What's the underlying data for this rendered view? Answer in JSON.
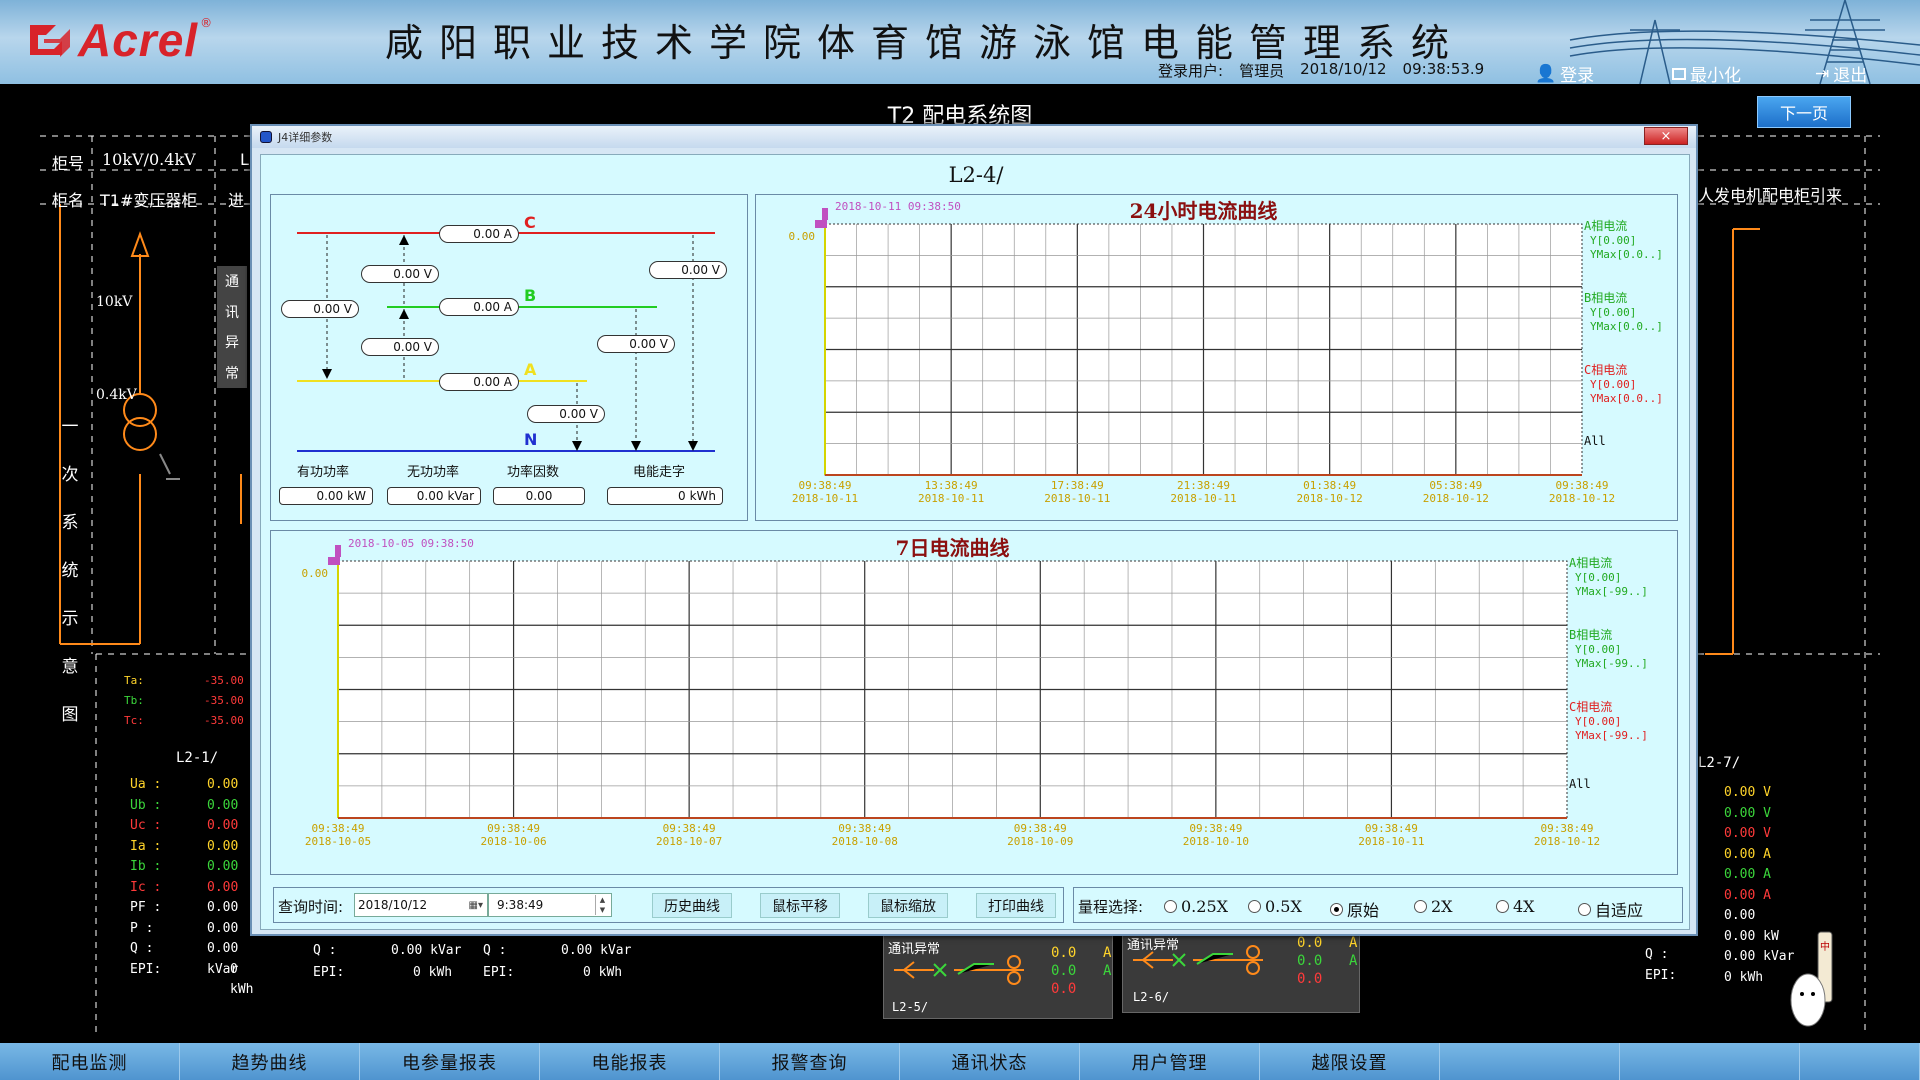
{
  "header": {
    "logo_text": "Acrel",
    "logo_reg": "®",
    "system_title": "咸阳职业技术学院体育馆游泳馆电能管理系统",
    "login_user_label": "登录用户:",
    "login_user": "管理员",
    "date": "2018/10/12",
    "time": "09:38:53.9",
    "login_btn": "登录",
    "minimize_btn": "最小化",
    "exit_btn": "退出"
  },
  "page": {
    "title": "T2 配电系统图",
    "next_page": "下一页"
  },
  "background": {
    "cabinet_no_label": "柜号",
    "cabinet_no_value": "10kV/0.4kV",
    "cabinet_no_next": "L",
    "cabinet_name_label": "柜名",
    "cabinet_name_value": "T1#变压器柜",
    "cabinet_name_next": "进",
    "right_header": "人发电机配电柜引来",
    "hv_label": "10kV",
    "lv_label": "0.4kV",
    "comm_error_vertical": [
      "通",
      "讯",
      "异",
      "常"
    ],
    "side_vertical": [
      "一",
      "次",
      "系",
      "统",
      "示",
      "意",
      "图"
    ],
    "temps": [
      {
        "label": "Ta:",
        "value": "-35.00"
      },
      {
        "label": "Tb:",
        "value": "-35.00"
      },
      {
        "label": "Tc:",
        "value": "-35.00"
      }
    ],
    "left_feeder": "L2-1/",
    "right_feeder": "L2-7/",
    "left_params": [
      {
        "label": "Ua :",
        "value": "0.00"
      },
      {
        "label": "Ub :",
        "value": "0.00"
      },
      {
        "label": "Uc :",
        "value": "0.00"
      },
      {
        "label": "Ia :",
        "value": "0.00"
      },
      {
        "label": "Ib :",
        "value": "0.00"
      },
      {
        "label": "Ic :",
        "value": "0.00"
      },
      {
        "label": "PF :",
        "value": "0.00"
      },
      {
        "label": "P :",
        "value": "0.00"
      },
      {
        "label": "Q :",
        "value": "0.00 kVar"
      },
      {
        "label": "EPI:",
        "value": "0 kWh"
      }
    ],
    "mid_q": [
      {
        "label": "Q :",
        "value": "0.00 kVar"
      },
      {
        "label": "Q :",
        "value": "0.00 kVar"
      }
    ],
    "mid_epi": [
      {
        "label": "EPI:",
        "value": "0 kWh"
      },
      {
        "label": "EPI:",
        "value": "0 kWh"
      }
    ],
    "right_params": [
      "0.00 V",
      "0.00 V",
      "0.00 V",
      "0.00 A",
      "0.00 A",
      "0.00 A",
      "0.00",
      "0.00 kW",
      "0.00 kVar",
      "0 kWh"
    ],
    "right_q_label": "Q :",
    "right_epi_label": "EPI:",
    "l25_comm": "通讯异常",
    "l25_name": "L2-5/",
    "l26_comm": "通讯异常",
    "l26_name": "L2-6/",
    "l25_vals": [
      "0.0",
      "0.0",
      "0.0"
    ],
    "l26_vals": [
      "0.0",
      "0.0",
      "0.0"
    ],
    "unit_a": "A"
  },
  "dialog": {
    "window_title": "J4详细参数",
    "close": "×",
    "heading": "L2-4/",
    "phases": {
      "c": "C",
      "b": "B",
      "a": "A",
      "n": "N"
    },
    "values": {
      "ic": "0.00 A",
      "ib": "0.00 A",
      "ia": "0.00 A",
      "ubc": "0.00 V",
      "uab": "0.00 V",
      "uca": "0.00 V",
      "uc": "0.00 V",
      "ub": "0.00 V",
      "ua": "0.00 V"
    },
    "power_labels": [
      "有功功率",
      "无功功率",
      "功率因数",
      "电能走字"
    ],
    "power_values": [
      {
        "num": "0.00",
        "unit": "kW"
      },
      {
        "num": "0.00",
        "unit": "kVar"
      },
      {
        "num": "0.00",
        "unit": ""
      },
      {
        "num": "0",
        "unit": "kWh"
      }
    ],
    "query_label": "查询时间:",
    "query_date": "2018/10/12",
    "query_time": "9:38:49",
    "buttons": [
      "历史曲线",
      "鼠标平移",
      "鼠标缩放",
      "打印曲线"
    ],
    "range_label": "量程选择:",
    "range_options": [
      "0.25X",
      "0.5X",
      "原始",
      "2X",
      "4X",
      "自适应"
    ],
    "range_selected": 2
  },
  "chart_data": [
    {
      "type": "line",
      "title": "24小时电流曲线",
      "cursor_label": "2018-10-11 09:38:50",
      "y_value_label": "0.00",
      "x": [
        [
          "09:38:49",
          "2018-10-11"
        ],
        [
          "13:38:49",
          "2018-10-11"
        ],
        [
          "17:38:49",
          "2018-10-11"
        ],
        [
          "21:38:49",
          "2018-10-11"
        ],
        [
          "01:38:49",
          "2018-10-12"
        ],
        [
          "05:38:49",
          "2018-10-12"
        ],
        [
          "09:38:49",
          "2018-10-12"
        ]
      ],
      "series": [
        {
          "name": "A相电流",
          "y": "Y[0.00]",
          "ymax": "YMax[0.0..]",
          "values": [
            0,
            0,
            0,
            0,
            0,
            0,
            0
          ],
          "color": "#22aa22"
        },
        {
          "name": "B相电流",
          "y": "Y[0.00]",
          "ymax": "YMax[0.0..]",
          "values": [
            0,
            0,
            0,
            0,
            0,
            0,
            0
          ],
          "color": "#22aa22"
        },
        {
          "name": "C相电流",
          "y": "Y[0.00]",
          "ymax": "YMax[0.0..]",
          "values": [
            0,
            0,
            0,
            0,
            0,
            0,
            0
          ],
          "color": "#e02020"
        }
      ],
      "legend_all": "All",
      "grid": true
    },
    {
      "type": "line",
      "title": "7日电流曲线",
      "cursor_label": "2018-10-05 09:38:50",
      "y_value_label": "0.00",
      "x": [
        [
          "09:38:49",
          "2018-10-05"
        ],
        [
          "09:38:49",
          "2018-10-06"
        ],
        [
          "09:38:49",
          "2018-10-07"
        ],
        [
          "09:38:49",
          "2018-10-08"
        ],
        [
          "09:38:49",
          "2018-10-09"
        ],
        [
          "09:38:49",
          "2018-10-10"
        ],
        [
          "09:38:49",
          "2018-10-11"
        ],
        [
          "09:38:49",
          "2018-10-12"
        ]
      ],
      "series": [
        {
          "name": "A相电流",
          "y": "Y[0.00]",
          "ymax": "YMax[-99..]",
          "values": [
            0,
            0,
            0,
            0,
            0,
            0,
            0,
            0
          ],
          "color": "#22aa22"
        },
        {
          "name": "B相电流",
          "y": "Y[0.00]",
          "ymax": "YMax[-99..]",
          "values": [
            0,
            0,
            0,
            0,
            0,
            0,
            0,
            0
          ],
          "color": "#22aa22"
        },
        {
          "name": "C相电流",
          "y": "Y[0.00]",
          "ymax": "YMax[-99..]",
          "values": [
            0,
            0,
            0,
            0,
            0,
            0,
            0,
            0
          ],
          "color": "#e02020"
        }
      ],
      "legend_all": "All",
      "grid": true
    }
  ],
  "navbar": [
    "配电监测",
    "趋势曲线",
    "电参量报表",
    "电能报表",
    "报警查询",
    "通讯状态",
    "用户管理",
    "越限设置",
    "",
    "",
    ""
  ]
}
